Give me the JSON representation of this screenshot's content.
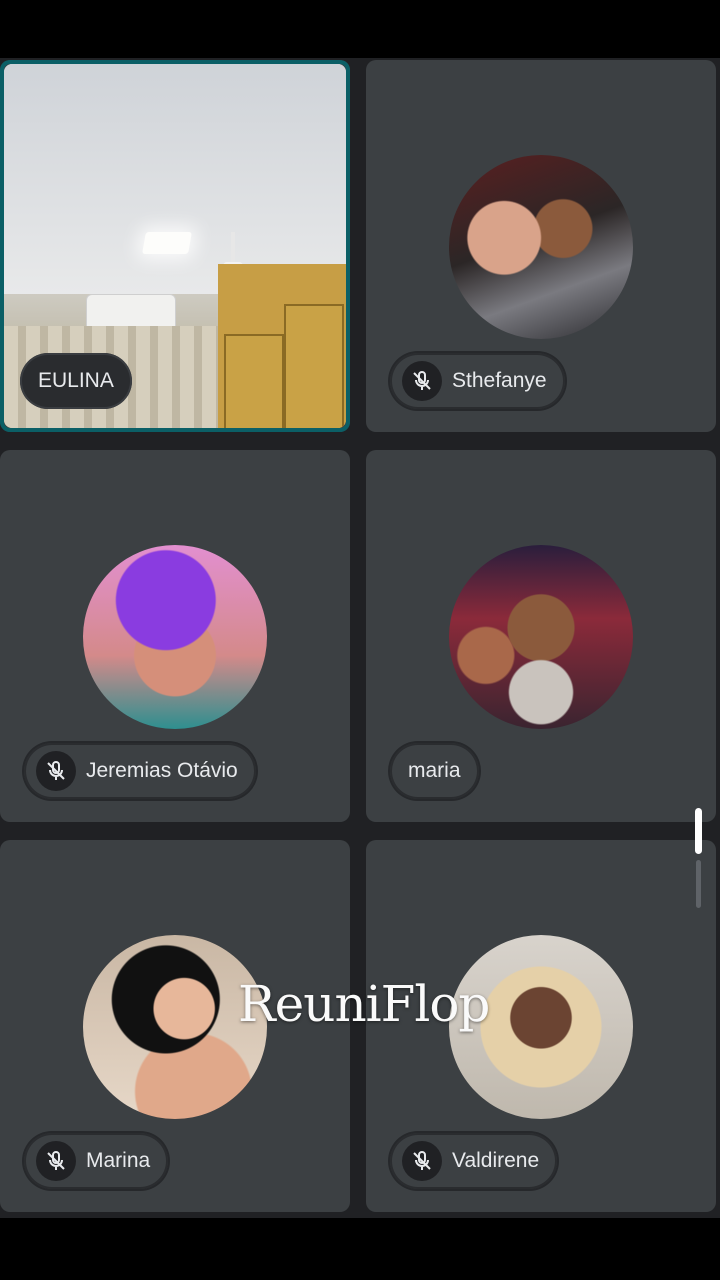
{
  "participants": [
    {
      "name": "EULINA",
      "muted": false,
      "video_on": true,
      "active_speaker": true
    },
    {
      "name": "Sthefanye",
      "muted": true,
      "video_on": false,
      "avatar": "photo-avatar"
    },
    {
      "name": "Jeremias Otávio",
      "muted": true,
      "video_on": false,
      "avatar": "photo-avatar"
    },
    {
      "name": "maria",
      "muted": false,
      "video_on": false,
      "avatar": "photo-avatar"
    },
    {
      "name": "Marina",
      "muted": true,
      "video_on": false,
      "avatar": "photo-avatar"
    },
    {
      "name": "Valdirene",
      "muted": true,
      "video_on": false,
      "avatar": "photo-avatar"
    }
  ],
  "icons": {
    "mic_off": "mic-off-icon"
  },
  "watermark": {
    "logo_text": "ReuniFlop"
  },
  "colors": {
    "background": "#202124",
    "tile": "#3c4043",
    "active_border": "#0b5f66",
    "chip_text": "#e8eaed"
  }
}
